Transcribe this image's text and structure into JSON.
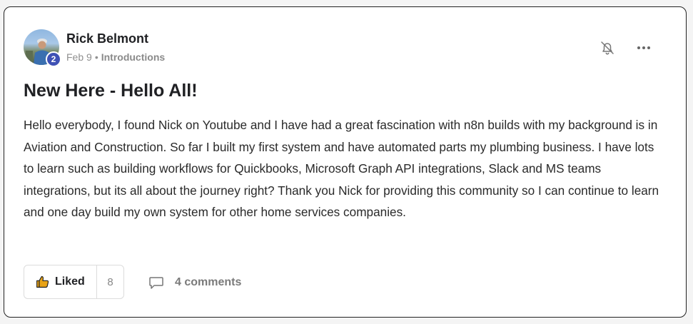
{
  "post": {
    "author": "Rick Belmont",
    "level": "2",
    "date": "Feb 9",
    "separator": "•",
    "category": "Introductions",
    "title": "New Here - Hello All!",
    "body": "Hello everybody, I found Nick on Youtube and I have had a great fascination with n8n builds with my background is in Aviation and Construction. So far I built my first system and have automated parts my plumbing business. I have lots to learn such as building workflows for Quickbooks, Microsoft Graph API integrations, Slack and MS teams integrations, but its all about the journey right? Thank you Nick for providing this community so I can continue to learn and one day build my own system for other home services companies."
  },
  "actions": {
    "like_label": "Liked",
    "like_count": "8",
    "comments_label": "4 comments"
  },
  "icons": {
    "bell": "bell-off-icon",
    "more": "more-horizontal-icon",
    "like": "thumbs-up-icon",
    "comment": "comment-icon"
  },
  "colors": {
    "level_badge": "#3f51b5",
    "like_icon": "#e8a317",
    "muted_text": "#909090"
  }
}
